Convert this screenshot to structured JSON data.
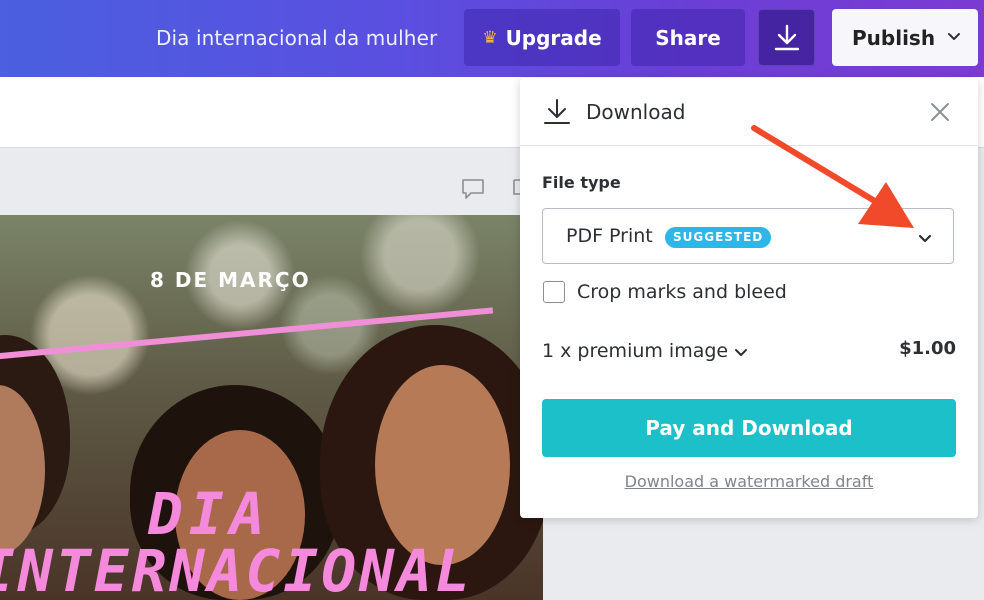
{
  "topbar": {
    "document_title": "Dia internacional da mulher",
    "upgrade_label": "Upgrade",
    "share_label": "Share",
    "publish_label": "Publish"
  },
  "design": {
    "date_text": "8 DE MARÇO",
    "headline_line1": "DIA",
    "headline_line2": "INTERNACIONAL"
  },
  "download_panel": {
    "title": "Download",
    "file_type_label": "File type",
    "file_type_value": "PDF Print",
    "suggested_badge": "SUGGESTED",
    "crop_marks_label": "Crop marks and bleed",
    "premium_label": "1 x premium image",
    "price": "$1.00",
    "pay_button_label": "Pay and Download",
    "draft_link": "Download a watermarked draft"
  },
  "colors": {
    "topbar_start": "#4b5fe0",
    "topbar_end": "#7b3bd3",
    "primary_button": "#1cc0c9",
    "badge": "#2fb6e8",
    "design_pink": "#f589db",
    "annotation_arrow": "#f04a2a"
  },
  "icons": [
    "crown-icon",
    "download-icon",
    "chevron-down-icon",
    "close-icon",
    "comment-icon",
    "copy-icon"
  ]
}
